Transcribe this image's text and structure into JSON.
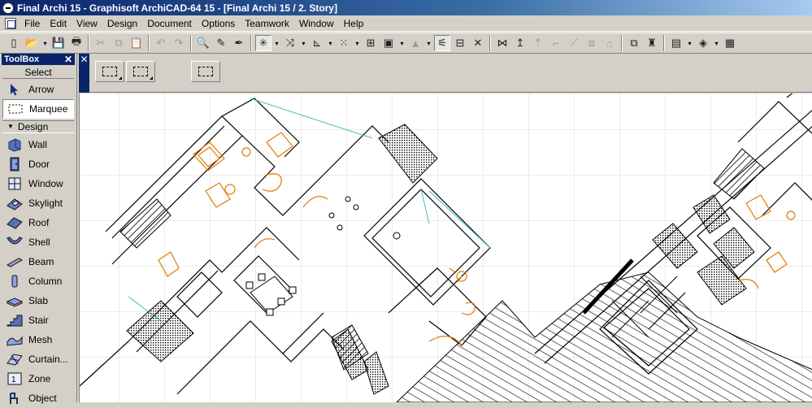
{
  "window": {
    "title": "Final Archi 15 - Graphisoft ArchiCAD-64 15 - [Final Archi 15 / 2. Story]"
  },
  "menu": {
    "items": [
      "File",
      "Edit",
      "View",
      "Design",
      "Document",
      "Options",
      "Teamwork",
      "Window",
      "Help"
    ]
  },
  "toolbox": {
    "title": "ToolBox",
    "close": "✕",
    "select_label": "Select",
    "select_tools": [
      {
        "label": "Arrow",
        "icon": "arrow-icon"
      },
      {
        "label": "Marquee",
        "icon": "marquee-icon"
      }
    ],
    "design_label": "Design",
    "design_tools": [
      {
        "label": "Wall",
        "icon": "wall-icon"
      },
      {
        "label": "Door",
        "icon": "door-icon"
      },
      {
        "label": "Window",
        "icon": "window-icon"
      },
      {
        "label": "Skylight",
        "icon": "skylight-icon"
      },
      {
        "label": "Roof",
        "icon": "roof-icon"
      },
      {
        "label": "Shell",
        "icon": "shell-icon"
      },
      {
        "label": "Beam",
        "icon": "beam-icon"
      },
      {
        "label": "Column",
        "icon": "column-icon"
      },
      {
        "label": "Slab",
        "icon": "slab-icon"
      },
      {
        "label": "Stair",
        "icon": "stair-icon"
      },
      {
        "label": "Mesh",
        "icon": "mesh-icon"
      },
      {
        "label": "Curtain...",
        "icon": "curtain-wall-icon"
      },
      {
        "label": "Zone",
        "icon": "zone-icon"
      },
      {
        "label": "Object",
        "icon": "object-icon"
      }
    ]
  },
  "infobox": {
    "close": "✕"
  },
  "colors": {
    "title_bar": "#0a246a",
    "chrome": "#d4d0c8",
    "accent_orange": "#e07b00",
    "cyan_line": "#3cc0c0"
  }
}
